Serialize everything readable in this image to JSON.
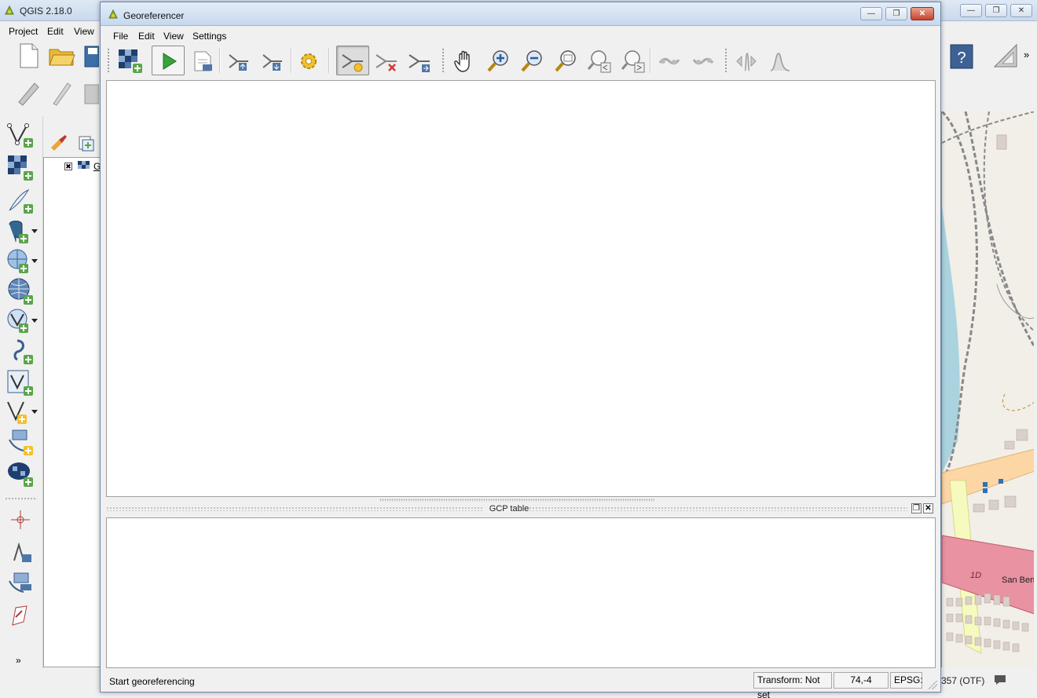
{
  "main_window": {
    "title": "QGIS 2.18.0",
    "menu": [
      "Project",
      "Edit",
      "View"
    ],
    "toolbar_icons": [
      "new-project-icon",
      "open-project-icon",
      "save-project-icon",
      "help-icon",
      "measure-icon"
    ],
    "overflow_glyph": "»",
    "left_toolbar_icons": [
      "add-vector-layer-icon",
      "add-raster-layer-icon",
      "add-delimited-text-layer-icon",
      "add-postgis-layer-icon",
      "add-wms-layer-icon",
      "add-wcs-layer-icon",
      "add-wfs-layer-icon",
      "add-spatialite-layer-icon",
      "new-shapefile-layer-icon",
      "new-temporary-layer-icon",
      "add-virtual-layer-icon",
      "add-oracle-layer-icon"
    ],
    "layers_panel": {
      "layer_label": "G"
    },
    "status": {
      "epsg_partial": "357 (OTF)"
    },
    "map_labels": {
      "route": "1D",
      "street": "San Ben"
    },
    "more_glyph": "»"
  },
  "georeferencer": {
    "title": "Georeferencer",
    "menu": [
      "File",
      "Edit",
      "View",
      "Settings"
    ],
    "toolbar": [
      {
        "name": "open-raster-icon"
      },
      {
        "name": "start-georeferencing-icon"
      },
      {
        "name": "generate-gdal-script-icon"
      },
      {
        "name": "load-gcp-points-icon"
      },
      {
        "name": "save-gcp-points-icon"
      },
      {
        "name": "transformation-settings-icon"
      },
      {
        "name": "add-point-icon"
      },
      {
        "name": "delete-point-icon"
      },
      {
        "name": "move-gcp-point-icon"
      },
      {
        "name": "pan-icon"
      },
      {
        "name": "zoom-in-icon"
      },
      {
        "name": "zoom-out-icon"
      },
      {
        "name": "zoom-to-layer-icon"
      },
      {
        "name": "zoom-last-icon"
      },
      {
        "name": "zoom-next-icon"
      },
      {
        "name": "link-georeferencer-to-qgis-icon"
      },
      {
        "name": "link-qgis-to-georeferencer-icon"
      },
      {
        "name": "full-histogram-stretch-icon"
      },
      {
        "name": "local-histogram-stretch-icon"
      }
    ],
    "gcp_table": {
      "title": "GCP table"
    },
    "status": {
      "message": "Start georeferencing",
      "transform": "Transform: Not set",
      "coordinates": "74,-4",
      "epsg": "EPSG:"
    },
    "window_buttons": {
      "minimize": "—",
      "maximize": "❐",
      "close": "✕"
    }
  }
}
